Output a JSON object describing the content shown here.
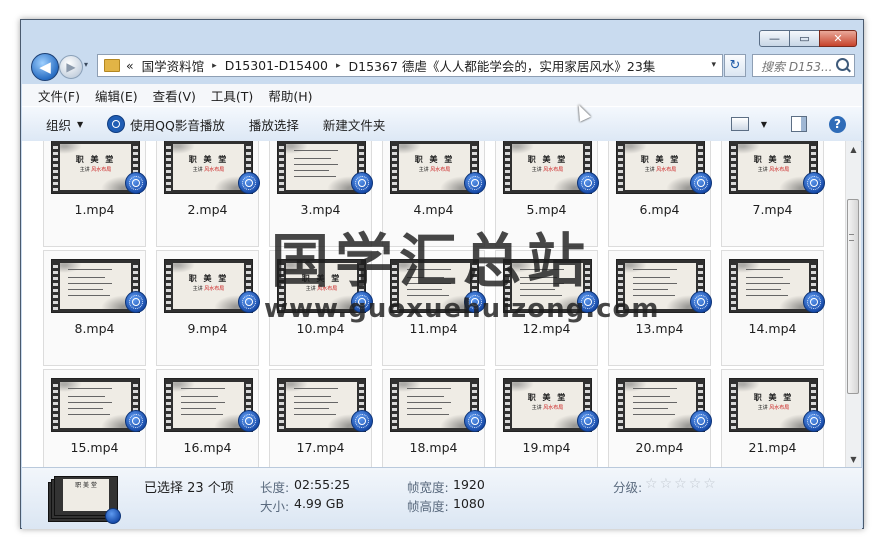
{
  "window": {
    "caption_buttons": {
      "minimize": "—",
      "maximize": "▭",
      "close": "✕"
    }
  },
  "nav": {
    "back_icon": "◀",
    "forward_icon": "▶",
    "history_icon": "▾"
  },
  "address": {
    "prefix": "«",
    "crumbs": [
      "国学资料馆",
      "D15301-D15400",
      "D15367 德虐《人人都能学会的，实用家居风水》23集"
    ],
    "dropdown_icon": "▾"
  },
  "refresh_icon": "↻",
  "search": {
    "placeholder": "搜索 D153..."
  },
  "menu": [
    "文件(F)",
    "编辑(E)",
    "查看(V)",
    "工具(T)",
    "帮助(H)"
  ],
  "toolbar": {
    "organize": "组织",
    "play_qq": "使用QQ影音播放",
    "play_selection": "播放选择",
    "new_folder": "新建文件夹",
    "help": "?"
  },
  "files": [
    {
      "name": "1.mp4",
      "slide": "title"
    },
    {
      "name": "2.mp4",
      "slide": "title"
    },
    {
      "name": "3.mp4",
      "slide": "list"
    },
    {
      "name": "4.mp4",
      "slide": "title"
    },
    {
      "name": "5.mp4",
      "slide": "title"
    },
    {
      "name": "6.mp4",
      "slide": "title"
    },
    {
      "name": "7.mp4",
      "slide": "title"
    },
    {
      "name": "8.mp4",
      "slide": "list"
    },
    {
      "name": "9.mp4",
      "slide": "title"
    },
    {
      "name": "10.mp4",
      "slide": "title"
    },
    {
      "name": "11.mp4",
      "slide": "list"
    },
    {
      "name": "12.mp4",
      "slide": "list"
    },
    {
      "name": "13.mp4",
      "slide": "list"
    },
    {
      "name": "14.mp4",
      "slide": "list"
    },
    {
      "name": "15.mp4",
      "slide": "list"
    },
    {
      "name": "16.mp4",
      "slide": "list"
    },
    {
      "name": "17.mp4",
      "slide": "list"
    },
    {
      "name": "18.mp4",
      "slide": "list"
    },
    {
      "name": "19.mp4",
      "slide": "title"
    },
    {
      "name": "20.mp4",
      "slide": "list"
    },
    {
      "name": "21.mp4",
      "slide": "title"
    }
  ],
  "slide_text": {
    "title": "职 美 堂",
    "subtitle": "主讲",
    "subtitle_red": "风水布局"
  },
  "details": {
    "selected": "已选择 23 个项",
    "length_label": "长度:",
    "length_value": "02:55:25",
    "size_label": "大小:",
    "size_value": "4.99 GB",
    "frame_width_label": "帧宽度:",
    "frame_width_value": "1920",
    "frame_height_label": "帧高度:",
    "frame_height_value": "1080",
    "rating_label": "分级:",
    "rating_value": 0,
    "rating_max": 5
  },
  "watermark": {
    "title": "国学汇总站",
    "url": "www.guoxuehuizong.com"
  }
}
